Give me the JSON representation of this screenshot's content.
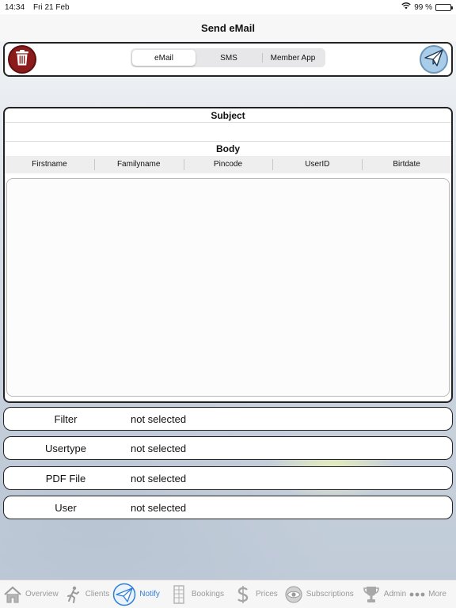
{
  "status_bar": {
    "time": "14:34",
    "date": "Fri 21 Feb",
    "battery_text": "99 %",
    "battery_level": 0.99
  },
  "nav": {
    "title": "Send eMail"
  },
  "toolbar": {
    "segments": [
      {
        "label": "eMail",
        "selected": true
      },
      {
        "label": "SMS",
        "selected": false
      },
      {
        "label": "Member App",
        "selected": false
      }
    ],
    "delete_icon": "trash-icon",
    "send_icon": "paper-plane-icon"
  },
  "compose": {
    "subject_heading": "Subject",
    "subject_value": "",
    "body_heading": "Body",
    "placeholders": [
      "Firstname",
      "Familyname",
      "Pincode",
      "UserID",
      "Birtdate"
    ],
    "body_value": ""
  },
  "selectors": [
    {
      "label": "Filter",
      "value": "not selected"
    },
    {
      "label": "Usertype",
      "value": "not selected"
    },
    {
      "label": "PDF File",
      "value": "not selected"
    },
    {
      "label": "User",
      "value": "not selected"
    }
  ],
  "tabs": [
    {
      "label": "Overview",
      "icon": "house-icon",
      "active": false
    },
    {
      "label": "Clients",
      "icon": "runner-icon",
      "active": false
    },
    {
      "label": "Notify",
      "icon": "paper-plane-icon",
      "active": true
    },
    {
      "label": "Bookings",
      "icon": "calendar-grid-icon",
      "active": false
    },
    {
      "label": "Prices",
      "icon": "dollar-icon",
      "active": false
    },
    {
      "label": "Subscriptions",
      "icon": "eye-badge-icon",
      "active": false
    },
    {
      "label": "Admin",
      "icon": "trophy-icon",
      "active": false
    },
    {
      "label": "More",
      "icon": "more-dots-icon",
      "active": false
    }
  ],
  "colors": {
    "accent": "#2f7fd9",
    "delete": "#8b1a1a",
    "send": "#a9cde9"
  }
}
